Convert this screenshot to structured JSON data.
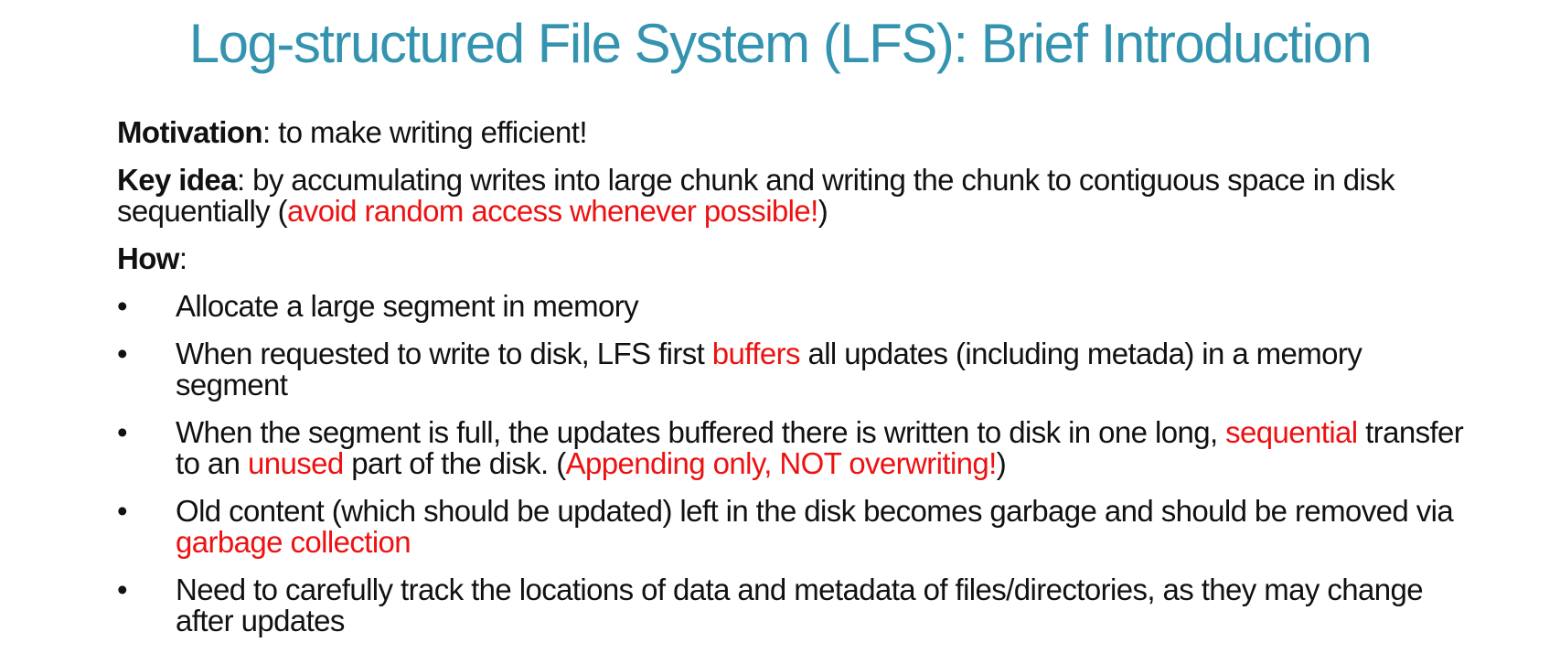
{
  "title": "Log-structured File System (LFS): Brief Introduction",
  "motivation": {
    "label": "Motivation",
    "text": ": to make writing efficient!"
  },
  "key_idea": {
    "label": "Key idea",
    "text": ": by accumulating writes into large chunk and writing the chunk to contiguous space in disk sequentially (",
    "highlight": "avoid random access whenever possible!",
    "tail": ")"
  },
  "how": {
    "label": "How",
    "text": ":"
  },
  "bullet_symbol": "•",
  "bullets": [
    {
      "t1": "Allocate a large segment in memory"
    },
    {
      "t1": "When requested to write to disk, LFS first ",
      "h1": "buffers",
      "t2": " all updates (including metada) in a memory segment"
    },
    {
      "t1": "When the segment is full, the updates buffered there is written to disk in one long, ",
      "h1": "sequential",
      "t2": " transfer to an ",
      "h2": "unused",
      "t3": " part of the disk. (",
      "h3": "Appending only, NOT overwriting!",
      "t4": ")"
    },
    {
      "t1": "Old content (which should be updated) left in the disk becomes garbage and should be removed via ",
      "h1": "garbage collection"
    },
    {
      "t1": "Need to carefully track the locations of data and metadata of files/directories, as they may change after updates"
    }
  ],
  "colors": {
    "title": "#3494b0",
    "highlight": "#ee1111",
    "text": "#111111"
  }
}
